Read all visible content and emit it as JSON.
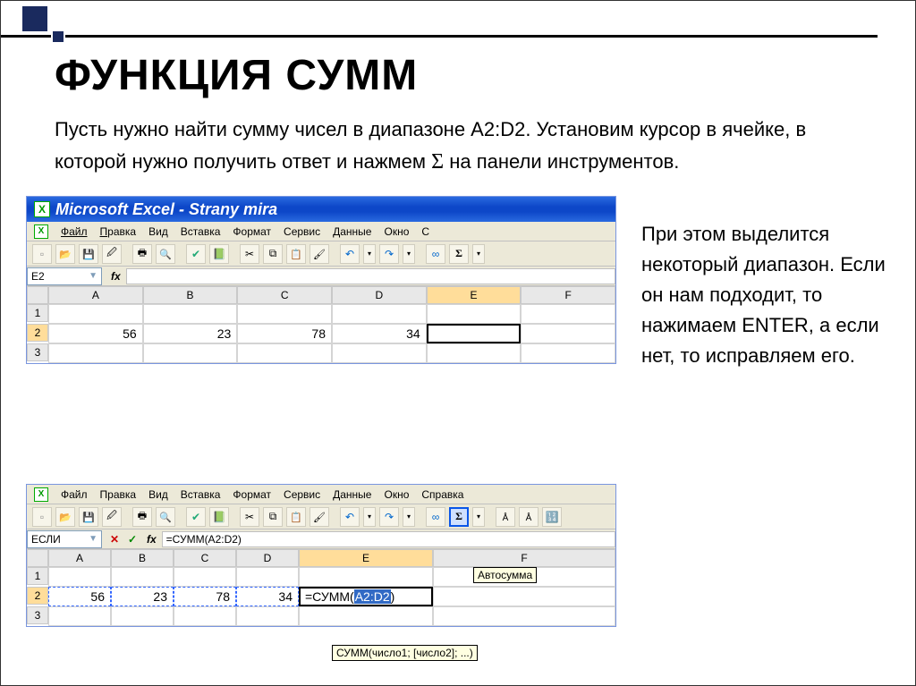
{
  "title": "ФУНКЦИЯ СУММ",
  "intro_1": "Пусть нужно найти сумму чисел в диапазоне A2:D2. Установим курсор в ячейке, в которой нужно получить ответ и нажмем ",
  "intro_2": " на панели инструментов.",
  "sigma": "Σ",
  "right_text": "При этом выделится некоторый диапазон. Если он нам подходит, то нажимаем ENTER, а если нет, то исправляем его.",
  "excel1": {
    "title": "Microsoft Excel - Strany mira",
    "menus": [
      "Файл",
      "Правка",
      "Вид",
      "Вставка",
      "Формат",
      "Сервис",
      "Данные",
      "Окно",
      "С"
    ],
    "namebox": "E2",
    "cols": [
      "A",
      "B",
      "C",
      "D",
      "E",
      "F"
    ],
    "active_col_index": 4,
    "rows": [
      "1",
      "2",
      "3"
    ],
    "active_row_index": 1,
    "data_row": [
      "56",
      "23",
      "78",
      "34",
      "",
      ""
    ]
  },
  "excel2": {
    "menus": [
      "Файл",
      "Правка",
      "Вид",
      "Вставка",
      "Формат",
      "Сервис",
      "Данные",
      "Окно",
      "Справка"
    ],
    "namebox": "ЕСЛИ",
    "formula": "=СУММ(A2:D2)",
    "tooltip_autosum": "Автосумма",
    "cols": [
      "A",
      "B",
      "C",
      "D",
      "E",
      "F"
    ],
    "active_col_index": 4,
    "rows": [
      "1",
      "2",
      "3"
    ],
    "active_row_index": 1,
    "data_row": [
      "56",
      "23",
      "78",
      "34",
      "",
      ""
    ],
    "e2_prefix": "=СУММ(",
    "e2_arg": "A2:D2",
    "e2_suffix": ")",
    "tooltip_syntax": "СУММ(число1; [число2]; ...)"
  },
  "chart_data": {
    "type": "table",
    "title": "Excel row A2:D2 with СУММ formula entered in E2",
    "categories": [
      "A2",
      "B2",
      "C2",
      "D2"
    ],
    "values": [
      56,
      23,
      78,
      34
    ],
    "formula_cell": "E2",
    "formula": "=СУММ(A2:D2)"
  }
}
